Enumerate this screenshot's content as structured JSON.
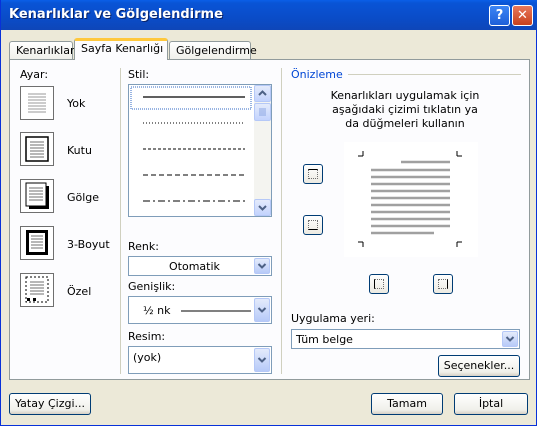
{
  "window": {
    "title": "Kenarlıklar ve Gölgelendirme",
    "help_glyph": "?",
    "close_glyph": "✕"
  },
  "tabs": [
    {
      "label": "Kenarlıklar",
      "active": false
    },
    {
      "label": "Sayfa Kenarlığı",
      "active": true
    },
    {
      "label": "Gölgelendirme",
      "active": false
    }
  ],
  "settings": {
    "heading": "Ayar:",
    "items": [
      {
        "label": "Yok",
        "icon": "setting-none-icon"
      },
      {
        "label": "Kutu",
        "icon": "setting-box-icon"
      },
      {
        "label": "Gölge",
        "icon": "setting-shadow-icon"
      },
      {
        "label": "3-Boyut",
        "icon": "setting-3d-icon"
      },
      {
        "label": "Özel",
        "icon": "setting-custom-icon"
      }
    ]
  },
  "style": {
    "heading": "Stil:",
    "line_styles": [
      "solid",
      "dotted",
      "dashed-small",
      "dashed",
      "dash-dot"
    ]
  },
  "color": {
    "label": "Renk:",
    "value": "Otomatik"
  },
  "width": {
    "label": "Genişlik:",
    "value": "½ nk"
  },
  "art": {
    "label": "Resim:",
    "value": "(yok)"
  },
  "preview": {
    "heading": "Önizleme",
    "instructions": "Kenarlıkları uygulamak için aşağıdaki çizimi tıklatın ya da düğmeleri kullanın"
  },
  "apply_to": {
    "label": "Uygulama yeri:",
    "value": "Tüm belge"
  },
  "buttons": {
    "options": "Seçenekler...",
    "horizontal_line": "Yatay Çizgi...",
    "ok": "Tamam",
    "cancel": "İptal"
  },
  "colors": {
    "titlebar": "#0A4CC8",
    "face": "#ECE9D8",
    "panel": "#FCFCFE",
    "accent_tab": "#FFC83C",
    "separator_heading": "#0046D5"
  }
}
